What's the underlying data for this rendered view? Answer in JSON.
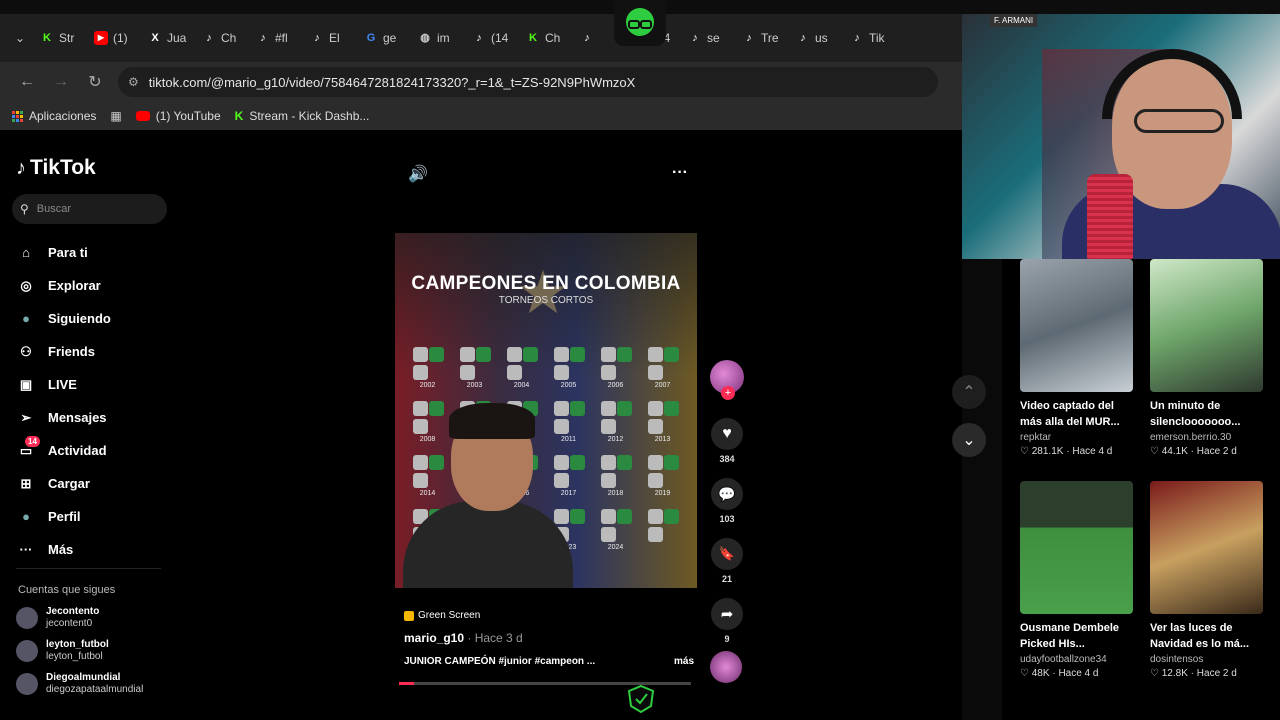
{
  "browser": {
    "tabs": [
      {
        "label": "Str",
        "icon": "kick-icon",
        "color": "#53fc18"
      },
      {
        "label": "(1)",
        "icon": "youtube-icon",
        "color": "#ff0000"
      },
      {
        "label": "Jua",
        "icon": "x-icon",
        "color": "#ffffff"
      },
      {
        "label": "Ch",
        "icon": "tiktok-icon",
        "color": "#ffffff"
      },
      {
        "label": "#fl",
        "icon": "tiktok-icon",
        "color": "#ffffff"
      },
      {
        "label": "El",
        "icon": "tiktok-icon",
        "color": "#ffffff"
      },
      {
        "label": "ge",
        "icon": "google-icon",
        "color": "#4285f4"
      },
      {
        "label": "im",
        "icon": "globe-icon",
        "color": "#cccccc"
      },
      {
        "label": "(14",
        "icon": "tiktok-icon",
        "color": "#ffffff"
      },
      {
        "label": "Ch",
        "icon": "kick-icon",
        "color": "#53fc18"
      },
      {
        "label": "",
        "icon": "tiktok-icon",
        "color": "#ffffff"
      },
      {
        "label": "(14",
        "icon": "tiktok-icon",
        "color": "#ffffff"
      },
      {
        "label": "se",
        "icon": "tiktok-icon",
        "color": "#ffffff"
      },
      {
        "label": "Tre",
        "icon": "tiktok-icon",
        "color": "#ffffff"
      },
      {
        "label": "us",
        "icon": "tiktok-icon",
        "color": "#ffffff"
      },
      {
        "label": "Tik",
        "icon": "tiktok-icon",
        "color": "#ffffff"
      }
    ],
    "url": "tiktok.com/@mario_g10/video/7584647281824173320?_r=1&_t=ZS-92N9PhWmzoX",
    "bookmarks": [
      {
        "label": "Aplicaciones",
        "icon": "apps-grid-icon"
      },
      {
        "label": "",
        "icon": "grid-icon"
      },
      {
        "label": "(1) YouTube",
        "icon": "youtube-icon"
      },
      {
        "label": "Stream - Kick Dashb...",
        "icon": "kick-icon"
      }
    ]
  },
  "tiktok": {
    "brand": "TikTok",
    "search_placeholder": "Buscar",
    "nav": [
      {
        "label": "Para ti",
        "icon": "home-icon"
      },
      {
        "label": "Explorar",
        "icon": "compass-icon"
      },
      {
        "label": "Siguiendo",
        "icon": "following-avatar-icon"
      },
      {
        "label": "Friends",
        "icon": "friends-icon"
      },
      {
        "label": "LIVE",
        "icon": "live-icon"
      },
      {
        "label": "Mensajes",
        "icon": "send-icon"
      },
      {
        "label": "Actividad",
        "icon": "inbox-icon",
        "badge": "14"
      },
      {
        "label": "Cargar",
        "icon": "upload-icon"
      },
      {
        "label": "Perfil",
        "icon": "profile-avatar-icon"
      },
      {
        "label": "Más",
        "icon": "more-dots-icon"
      }
    ],
    "following_heading": "Cuentas que sigues",
    "following": [
      {
        "name": "Jecontento",
        "user": "jecontent0"
      },
      {
        "name": "leyton_futbol",
        "user": "leyton_futbol"
      },
      {
        "name": "Diegoalmundial",
        "user": "diegozapataalmundial"
      }
    ]
  },
  "video": {
    "title": "CAMPEONES EN COLOMBIA",
    "subtitle": "TORNEOS CORTOS",
    "years": [
      "2002",
      "2003",
      "2004",
      "2005",
      "2006",
      "2007",
      "2008",
      "",
      "",
      "2011",
      "2012",
      "2013",
      "2014",
      "",
      "2016",
      "2017",
      "2018",
      "2019",
      "",
      "",
      "",
      "2023",
      "2024",
      ""
    ],
    "effect": "Green Screen",
    "author": "mario_g10",
    "ago": "· Hace 3 d",
    "caption": "JUNIOR CAMPEÓN #junior #campeon ...",
    "more": "más",
    "progress": 0.05,
    "likes": "384",
    "comments": "103",
    "saves": "21",
    "shares": "9"
  },
  "webcam": {
    "tag": "F. ARMANI"
  },
  "recommendations": [
    {
      "title": "Video captado del más alla del MUR...",
      "user": "repktar",
      "likes": "281.1K",
      "ago": "Hace 4 d"
    },
    {
      "title": "Un minuto de silenclooooooo...",
      "user": "emerson.berrio.30",
      "likes": "44.1K",
      "ago": "Hace 2 d"
    },
    {
      "title": "Ousmane Dembele Picked HIs...",
      "user": "udayfootballzone34",
      "likes": "48K",
      "ago": "Hace 4 d"
    },
    {
      "title": "Ver las luces de Navidad es lo má...",
      "user": "dosintensos",
      "likes": "12.8K",
      "ago": "Hace 2 d"
    }
  ],
  "colors": {
    "tiktok_red": "#fe2c55",
    "kick_green": "#53fc18"
  }
}
